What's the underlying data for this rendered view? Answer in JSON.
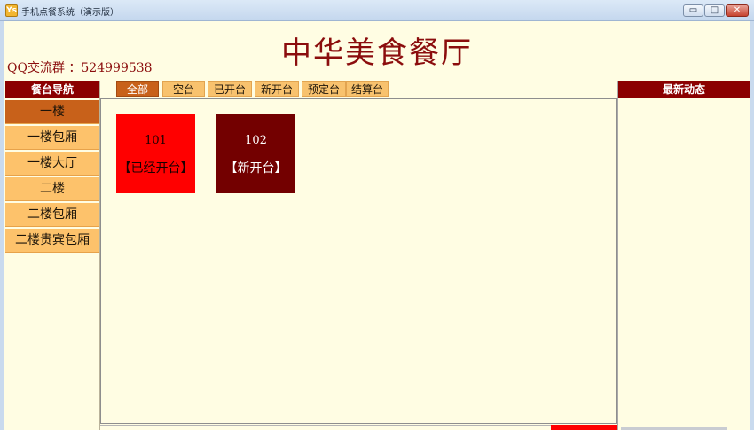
{
  "window": {
    "title": "手机点餐系统（演示版）",
    "icon_letter": "Ys",
    "buttons": {
      "minimize": "▭",
      "maximize": "□",
      "close": "✕"
    }
  },
  "header": {
    "restaurant_name": "中华美食餐厅",
    "qq_group": "QQ交流群 ：524999538"
  },
  "sidebar": {
    "title": "餐台导航",
    "items": [
      {
        "label": "一楼",
        "active": true
      },
      {
        "label": "一楼包厢"
      },
      {
        "label": "一楼大厅"
      },
      {
        "label": "二楼"
      },
      {
        "label": "二楼包厢"
      },
      {
        "label": "二楼贵宾包厢"
      }
    ]
  },
  "filters": {
    "tabs": [
      {
        "label": "全部",
        "active": true
      },
      {
        "label": "空台"
      },
      {
        "label": "已开台"
      },
      {
        "label": "新开台"
      },
      {
        "label": "预定台"
      },
      {
        "label": "结算台"
      }
    ]
  },
  "tables": [
    {
      "number": "101",
      "status": "【已经开台】",
      "color": "#FF0000"
    },
    {
      "number": "102",
      "status": "【新开台】",
      "color": "#730000"
    }
  ],
  "right_panel": {
    "title": "最新动态"
  },
  "colors": {
    "brand_dark_red": "#8B0000",
    "nav_orange": "#FDC26B",
    "nav_active": "#C8611A",
    "background": "#FFFDE3"
  }
}
